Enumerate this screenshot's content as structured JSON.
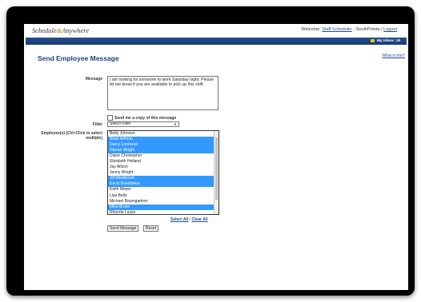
{
  "app": {
    "logo_text": "Schedule",
    "logo_amp": "&",
    "logo_text2": "Anywhere",
    "welcome_prefix": "Welcome,",
    "user_link": "Staff Scheduler",
    "location": "- SouthPointe |",
    "logout": "Logout"
  },
  "nav": {
    "items": [
      "Schedule",
      "Reports",
      "Set Up",
      "Manager",
      "Personal",
      "Help"
    ],
    "inbox": "My Inbox: 19"
  },
  "page": {
    "title": "Send Employee Message",
    "help_link": "What is this?"
  },
  "form": {
    "message_label": "Message",
    "message_value": "I am looking for someone to work Saturday night. Please let me know if you are available to pick up this shift.",
    "copy_label": "Send me a copy of this message",
    "filter_label": "Filter",
    "filter_value": "Select Filter",
    "employees_label": "Employee(s) (Ctrl-Click to select multiple)",
    "employees": [
      {
        "name": "Betty Johnson",
        "selected": false
      },
      {
        "name": "Brian Arfman",
        "selected": true
      },
      {
        "name": "Darcy Lorenzen",
        "selected": true
      },
      {
        "name": "Darren Wright",
        "selected": true
      },
      {
        "name": "Diane Christopher",
        "selected": false
      },
      {
        "name": "Elizabeth Holland",
        "selected": false
      },
      {
        "name": "Jay Alfson",
        "selected": false
      },
      {
        "name": "Jenny Wright",
        "selected": false
      },
      {
        "name": "Jill Westbrook",
        "selected": true
      },
      {
        "name": "Kevin Boeddeker",
        "selected": true
      },
      {
        "name": "Kieth Meyer",
        "selected": false
      },
      {
        "name": "Lisa Beltz",
        "selected": false
      },
      {
        "name": "Michael Baumgartner",
        "selected": false
      },
      {
        "name": "Mike Bronn",
        "selected": true
      },
      {
        "name": "Rhonda Lusso",
        "selected": false
      }
    ],
    "select_all": "Select All",
    "separator": "/",
    "clear_all": "Clear All",
    "send_button": "Send Message",
    "reset_button": "Reset"
  }
}
